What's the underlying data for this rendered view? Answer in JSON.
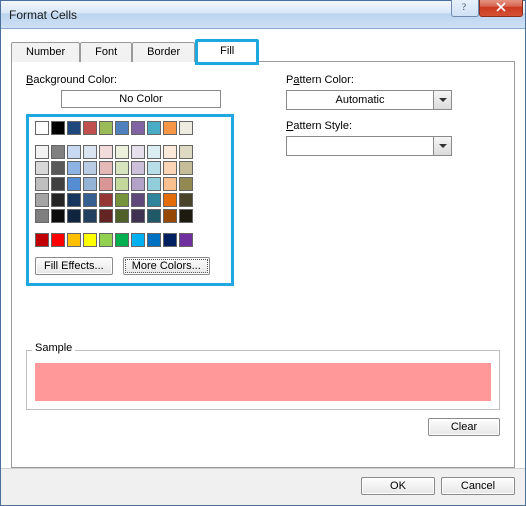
{
  "window": {
    "title": "Format Cells"
  },
  "tabs": {
    "t0": "Number",
    "t1": "Font",
    "t2": "Border",
    "t3": "Fill"
  },
  "labels": {
    "bgcolor": "Background Color:",
    "nocolor": "No Color",
    "fill_effects": "Fill Effects...",
    "more_colors": "More Colors...",
    "pattern_color": "Pattern Color:",
    "pattern_style": "Pattern Style:",
    "automatic": "Automatic",
    "sample": "Sample",
    "clear": "Clear",
    "ok": "OK",
    "cancel": "Cancel"
  },
  "palette": {
    "row1": [
      "#ffffff",
      "#000000",
      "#1f497d",
      "#c0504d",
      "#9bbb59",
      "#4f81bd",
      "#8064a2",
      "#4bacc6",
      "#f79646",
      "#eeece1"
    ],
    "theme": [
      [
        "#f2f2f2",
        "#808080",
        "#c6d9f0",
        "#dbe5f1",
        "#f2dcdb",
        "#ebf1dd",
        "#e5e0ec",
        "#dbeef3",
        "#fdeada",
        "#ddd9c3"
      ],
      [
        "#d8d8d8",
        "#595959",
        "#8db3e2",
        "#b8cce4",
        "#e5b9b7",
        "#d7e3bc",
        "#ccc1d9",
        "#b7dde8",
        "#fbd5b5",
        "#c4bd97"
      ],
      [
        "#bfbfbf",
        "#404040",
        "#548dd4",
        "#95b3d7",
        "#d99694",
        "#c3d69b",
        "#b2a2c7",
        "#92cddc",
        "#fac08f",
        "#938953"
      ],
      [
        "#a5a5a5",
        "#262626",
        "#17365d",
        "#366092",
        "#953734",
        "#76923c",
        "#5f497a",
        "#31859b",
        "#e36c09",
        "#494429"
      ],
      [
        "#7f7f7f",
        "#0c0c0c",
        "#0f243e",
        "#244061",
        "#632423",
        "#4f6128",
        "#3f3151",
        "#205867",
        "#974806",
        "#1d1b10"
      ]
    ],
    "std": [
      "#c00000",
      "#ff0000",
      "#ffc000",
      "#ffff00",
      "#92d050",
      "#00b050",
      "#00b0f0",
      "#0070c0",
      "#002060",
      "#7030a0"
    ]
  },
  "sample_color": "#ff9999"
}
